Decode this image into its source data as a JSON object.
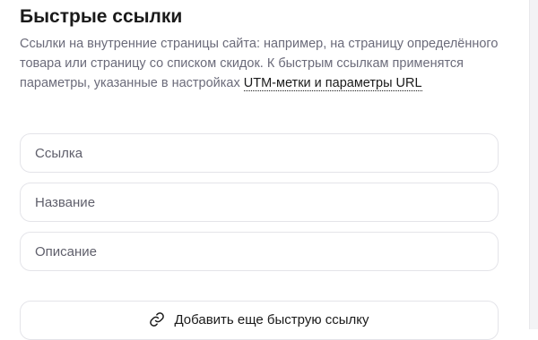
{
  "section": {
    "title": "Быстрые ссылки",
    "description_before_link": "Ссылки на внутренние страницы сайта: например, на страницу определённого товара или страницу со списком скидок. К быстрым ссылкам применятся параметры, указанные в настройках ",
    "description_link": "UTM-метки и параметры URL"
  },
  "fields": {
    "link_placeholder": "Ссылка",
    "name_placeholder": "Название",
    "description_placeholder": "Описание"
  },
  "add_button": {
    "label": "Добавить еще быструю ссылку",
    "icon": "link-icon"
  }
}
